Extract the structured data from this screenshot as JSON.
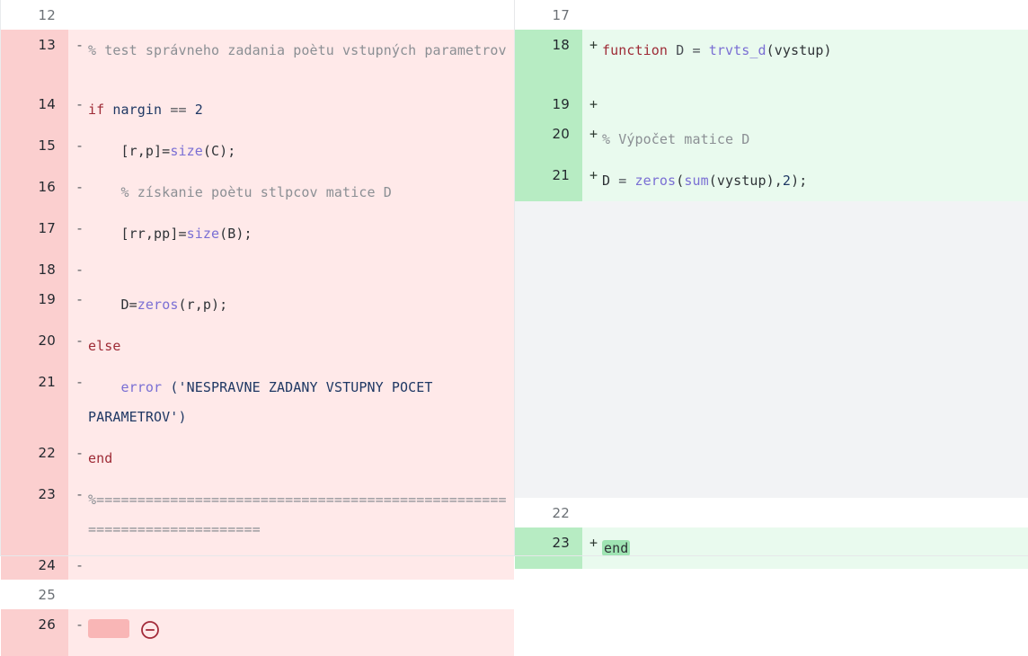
{
  "view": {
    "kind": "split-diff",
    "language": "matlab",
    "colors": {
      "deletion_bg": "#ffe9e9",
      "deletion_gutter_bg": "#fbcfcf",
      "addition_bg": "#e9faee",
      "addition_gutter_bg": "#b7ecc3",
      "context_bg": "#ffffff",
      "filler_bg": "#f2f3f5",
      "keyword": "#9e2b36",
      "function": "#7a6fd4",
      "comment": "#8b8f94",
      "string": "#1f3864",
      "number": "#1f3864",
      "icon_minus": "#a32b3a",
      "chip_deletion": "#f9b6b6",
      "chip_addition": "#9fe4b3"
    }
  },
  "left_pane": {
    "rows": [
      {
        "type": "context",
        "line_no": "12",
        "marker": "",
        "tokens": []
      },
      {
        "type": "deletion",
        "line_no": "13",
        "marker": "-",
        "tokens": [
          {
            "text": "% test správneho zadania poètu vstupných parametrov",
            "cls": "tok-comment"
          }
        ]
      },
      {
        "type": "deletion",
        "line_no": "14",
        "marker": "-",
        "tokens": [
          {
            "text": "if ",
            "cls": "tok-kw"
          },
          {
            "text": "nargin ",
            "cls": "tok-var"
          },
          {
            "text": "== ",
            "cls": "tok-op"
          },
          {
            "text": "2",
            "cls": "tok-num"
          }
        ]
      },
      {
        "type": "deletion",
        "line_no": "15",
        "marker": "-",
        "tokens": [
          {
            "text": "    [r,p]=",
            "cls": "tok-plain"
          },
          {
            "text": "size",
            "cls": "tok-fn"
          },
          {
            "text": "(C);",
            "cls": "tok-plain"
          }
        ]
      },
      {
        "type": "deletion",
        "line_no": "16",
        "marker": "-",
        "tokens": [
          {
            "text": "    % získanie poètu stlpcov matice D",
            "cls": "tok-comment"
          }
        ]
      },
      {
        "type": "deletion",
        "line_no": "17",
        "marker": "-",
        "tokens": [
          {
            "text": "    [rr,pp]=",
            "cls": "tok-plain"
          },
          {
            "text": "size",
            "cls": "tok-fn"
          },
          {
            "text": "(B);",
            "cls": "tok-plain"
          }
        ]
      },
      {
        "type": "deletion",
        "line_no": "18",
        "marker": "-",
        "tokens": []
      },
      {
        "type": "deletion",
        "line_no": "19",
        "marker": "-",
        "tokens": [
          {
            "text": "    D=",
            "cls": "tok-plain"
          },
          {
            "text": "zeros",
            "cls": "tok-fn"
          },
          {
            "text": "(r,p);",
            "cls": "tok-plain"
          }
        ]
      },
      {
        "type": "deletion",
        "line_no": "20",
        "marker": "-",
        "tokens": [
          {
            "text": "else",
            "cls": "tok-kw"
          }
        ]
      },
      {
        "type": "deletion",
        "line_no": "21",
        "marker": "-",
        "tokens": [
          {
            "text": "    error ",
            "cls": "tok-fn"
          },
          {
            "text": "('NESPRAVNE ZADANY VSTUPNY POCET PARAMETROV')",
            "cls": "tok-str"
          }
        ]
      },
      {
        "type": "deletion",
        "line_no": "22",
        "marker": "-",
        "tokens": [
          {
            "text": "end",
            "cls": "tok-kw"
          }
        ]
      },
      {
        "type": "deletion",
        "line_no": "23",
        "marker": "-",
        "tokens": [
          {
            "text": "%=======================================================================",
            "cls": "tok-comment"
          }
        ]
      },
      {
        "type": "deletion",
        "line_no": "24",
        "marker": "-",
        "tokens": []
      },
      {
        "type": "context",
        "line_no": "25",
        "marker": "",
        "tokens": []
      },
      {
        "type": "deletion",
        "line_no": "26",
        "marker": "-",
        "chip": "deleted-whitespace",
        "icon": "circle-minus-icon",
        "tokens": []
      }
    ]
  },
  "right_pane": {
    "rows": [
      {
        "type": "context",
        "line_no": "17",
        "marker": "",
        "tokens": []
      },
      {
        "type": "addition",
        "line_no": "18",
        "marker": "+",
        "tokens": [
          {
            "text": "function ",
            "cls": "tok-kw"
          },
          {
            "text": "D = ",
            "cls": "tok-op"
          },
          {
            "text": "trvts_d",
            "cls": "tok-fn"
          },
          {
            "text": "(vystup)",
            "cls": "tok-plain"
          }
        ]
      },
      {
        "type": "addition",
        "line_no": "19",
        "marker": "+",
        "tokens": []
      },
      {
        "type": "addition",
        "line_no": "20",
        "marker": "+",
        "tokens": [
          {
            "text": "% Výpočet matice D",
            "cls": "tok-comment"
          }
        ]
      },
      {
        "type": "addition",
        "line_no": "21",
        "marker": "+",
        "tokens": [
          {
            "text": "D ",
            "cls": "tok-plain"
          },
          {
            "text": "= ",
            "cls": "tok-op"
          },
          {
            "text": "zeros",
            "cls": "tok-fn"
          },
          {
            "text": "(",
            "cls": "tok-plain"
          },
          {
            "text": "sum",
            "cls": "tok-fn"
          },
          {
            "text": "(vystup),",
            "cls": "tok-plain"
          },
          {
            "text": "2",
            "cls": "tok-num"
          },
          {
            "text": ");",
            "cls": "tok-plain"
          }
        ]
      },
      {
        "type": "filler",
        "line_no": "",
        "marker": "",
        "tokens": []
      },
      {
        "type": "context",
        "line_no": "22",
        "marker": "",
        "tokens": []
      },
      {
        "type": "addition",
        "line_no": "23",
        "marker": "+",
        "chip_text": "end",
        "tokens": []
      }
    ]
  }
}
